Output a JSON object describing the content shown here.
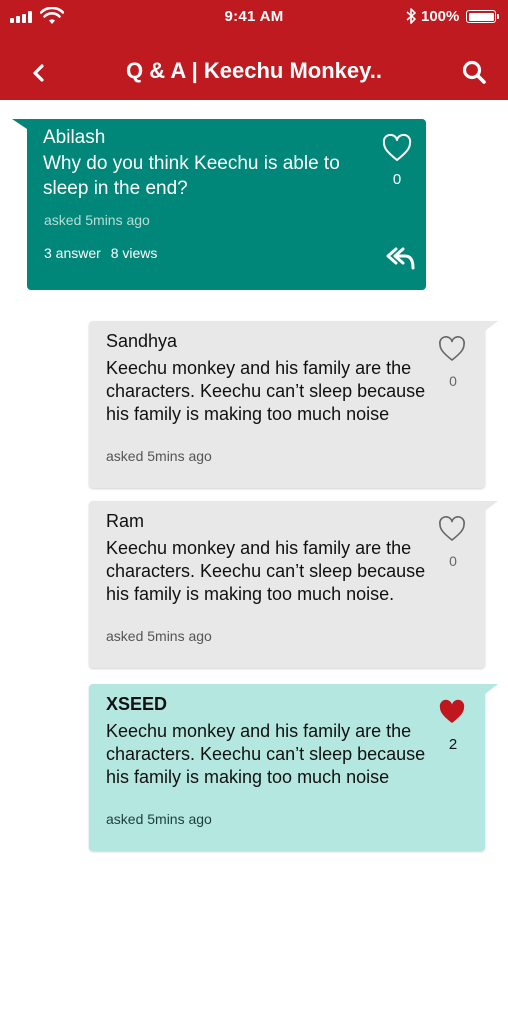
{
  "status_bar": {
    "time": "9:41 AM",
    "battery": "100%"
  },
  "header": {
    "title": "Q & A | Keechu Monkey.."
  },
  "question": {
    "author": "Abilash",
    "text": "Why do you think Keechu is able to sleep in the end?",
    "asked": "asked 5mins ago",
    "answers": "3 answer",
    "views": "8 views",
    "likes": "0"
  },
  "answers": [
    {
      "author": "Sandhya",
      "text": "Keechu monkey and his family are the characters. Keechu can’t sleep because his family is making too much noise",
      "asked": "asked 5mins ago",
      "likes": "0",
      "liked": false
    },
    {
      "author": "Ram",
      "text": "Keechu monkey and his family are the characters. Keechu can’t sleep because his family is making too much noise.",
      "asked": "asked 5mins ago",
      "likes": "0",
      "liked": false
    },
    {
      "author": "XSEED",
      "text": "Keechu monkey and his family are the characters. Keechu can’t sleep because his family is making too much noise",
      "asked": "asked 5mins ago",
      "likes": "2",
      "liked": true
    }
  ],
  "colors": {
    "header": "#bf1a1f",
    "question_card": "#00877a",
    "answer_card": "#e8e8e8",
    "highlight_card": "#b4e7e0",
    "liked_heart": "#c0161e"
  },
  "icons": {
    "back": "chevron-left-icon",
    "search": "search-icon",
    "like": "heart-icon",
    "reply": "reply-all-icon"
  }
}
